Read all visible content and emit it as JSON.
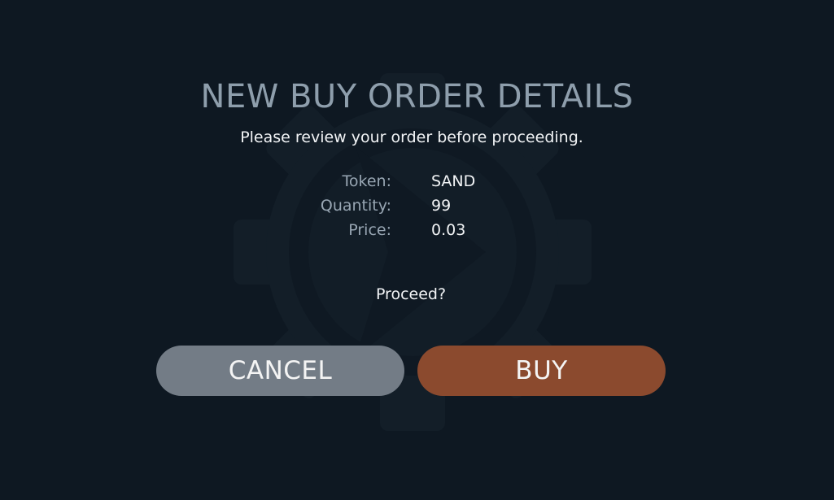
{
  "dialog": {
    "title": "NEW BUY ORDER DETAILS",
    "subtitle": "Please review your order before proceeding.",
    "details": [
      {
        "label": "Token:",
        "value": "SAND"
      },
      {
        "label": "Quantity:",
        "value": "99"
      },
      {
        "label": "Price:",
        "value": "0.03"
      }
    ],
    "prompt": "Proceed?",
    "cancel_label": "CANCEL",
    "buy_label": "BUY"
  },
  "colors": {
    "background": "#0e1822",
    "title": "#8e9eac",
    "cancel_button": "#737c86",
    "buy_button": "#8b4a2e"
  },
  "icons": {
    "watermark": "gear-arrow-logo-icon"
  }
}
